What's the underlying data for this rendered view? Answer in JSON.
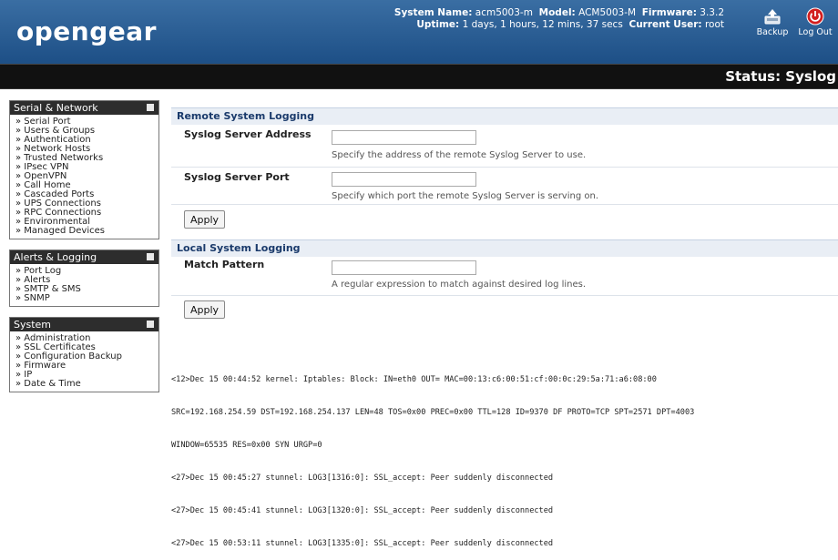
{
  "header": {
    "logo": "opengear",
    "system_name_label": "System Name:",
    "system_name": "acm5003-m",
    "model_label": "Model:",
    "model": "ACM5003-M",
    "firmware_label": "Firmware:",
    "firmware": "3.3.2",
    "uptime_label": "Uptime:",
    "uptime": "1 days, 1 hours, 12 mins, 37 secs",
    "current_user_label": "Current User:",
    "current_user": "root",
    "backup_label": "Backup",
    "logout_label": "Log Out"
  },
  "status": {
    "title": "Status: Syslog"
  },
  "sidebar": {
    "serial_network": {
      "title": "Serial & Network",
      "items": [
        "» Serial Port",
        "» Users & Groups",
        "» Authentication",
        "» Network Hosts",
        "» Trusted Networks",
        "» IPsec VPN",
        "» OpenVPN",
        "» Call Home",
        "» Cascaded Ports",
        "» UPS Connections",
        "» RPC Connections",
        "» Environmental",
        "» Managed Devices"
      ]
    },
    "alerts_logging": {
      "title": "Alerts & Logging",
      "items": [
        "» Port Log",
        "» Alerts",
        "» SMTP & SMS",
        "» SNMP"
      ]
    },
    "system": {
      "title": "System",
      "items": [
        "» Administration",
        "» SSL Certificates",
        "» Configuration Backup",
        "» Firmware",
        "» IP",
        "» Date & Time"
      ]
    }
  },
  "remote_logging": {
    "title": "Remote System Logging",
    "server_address_label": "Syslog Server Address",
    "server_address_value": "",
    "server_address_help": "Specify the address of the remote Syslog Server to use.",
    "server_port_label": "Syslog Server Port",
    "server_port_value": "",
    "server_port_help": "Specify which port the remote Syslog Server is serving on.",
    "apply_label": "Apply"
  },
  "local_logging": {
    "title": "Local System Logging",
    "match_pattern_label": "Match Pattern",
    "match_pattern_value": "",
    "match_pattern_help": "A regular expression to match against desired log lines.",
    "apply_label": "Apply"
  },
  "log_lines": [
    "<12>Dec 15 00:44:52 kernel: Iptables: Block: IN=eth0 OUT= MAC=00:13:c6:00:51:cf:00:0c:29:5a:71:a6:08:00",
    "SRC=192.168.254.59 DST=192.168.254.137 LEN=48 TOS=0x00 PREC=0x00 TTL=128 ID=9370 DF PROTO=TCP SPT=2571 DPT=4003",
    "WINDOW=65535 RES=0x00 SYN URGP=0",
    "<27>Dec 15 00:45:27 stunnel: LOG3[1316:0]: SSL_accept: Peer suddenly disconnected",
    "<27>Dec 15 00:45:41 stunnel: LOG3[1320:0]: SSL_accept: Peer suddenly disconnected",
    "<27>Dec 15 00:53:11 stunnel: LOG3[1335:0]: SSL_accept: Peer suddenly disconnected"
  ]
}
